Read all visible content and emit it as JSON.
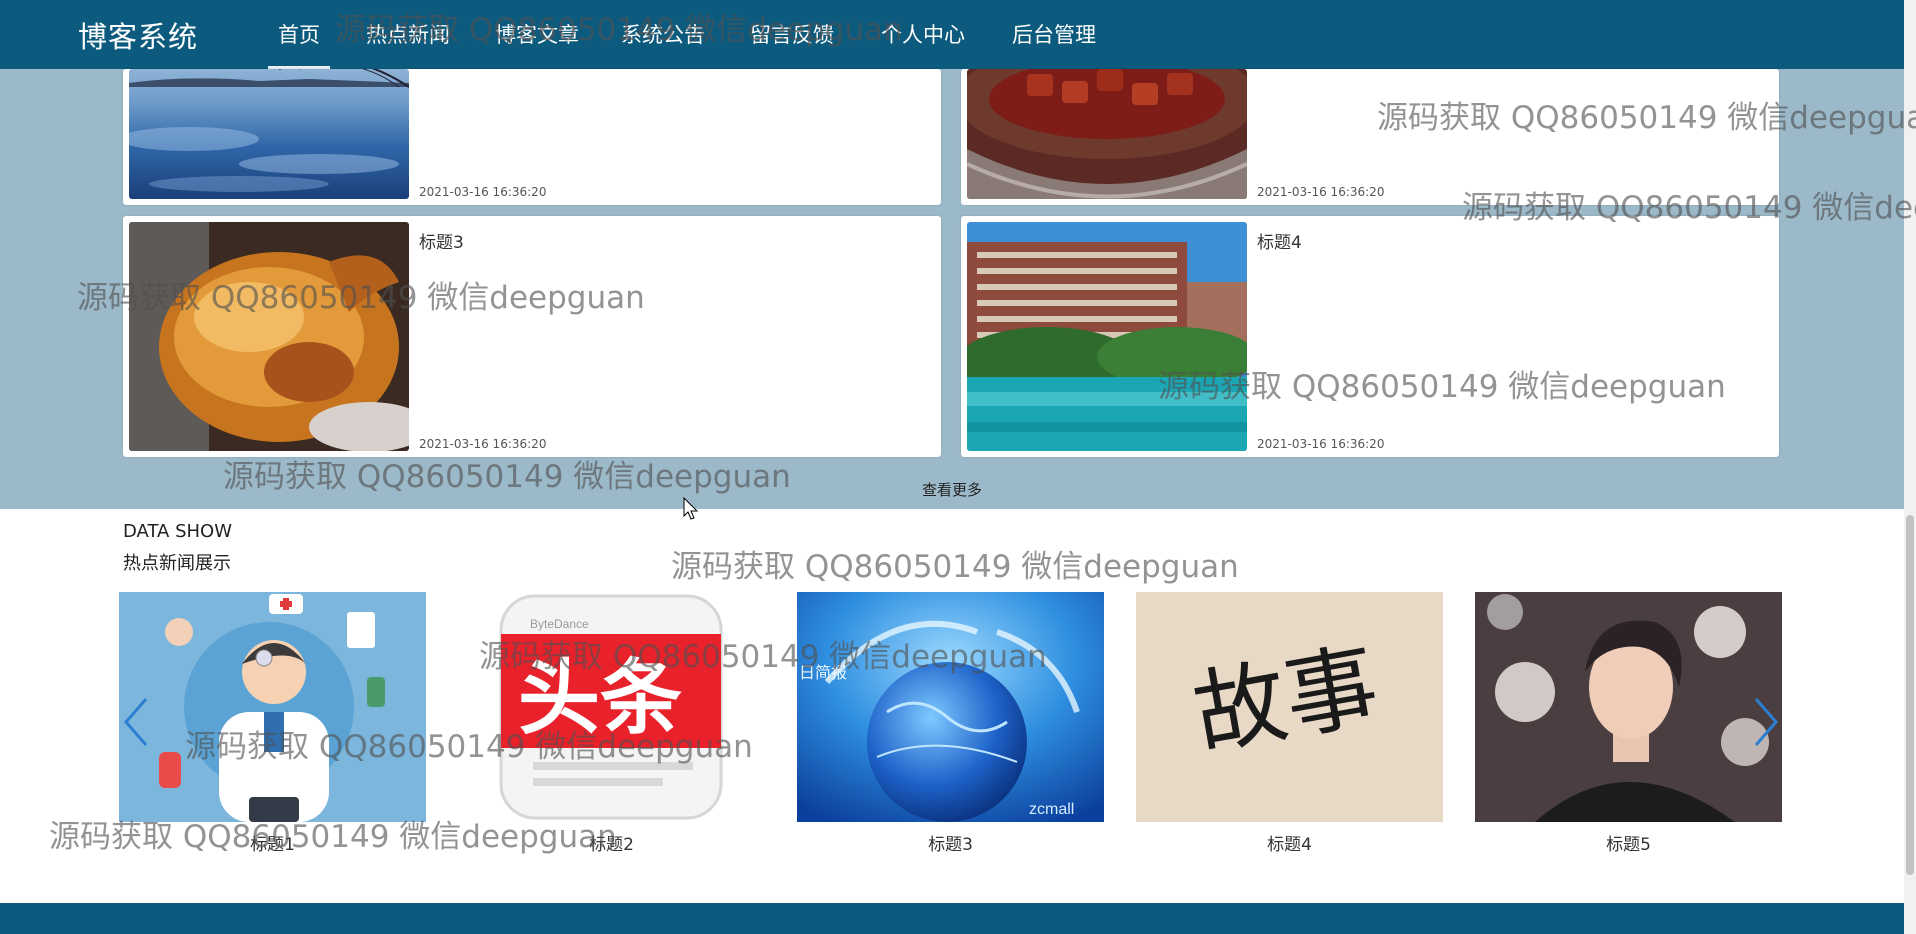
{
  "nav": {
    "brand": "博客系统",
    "items": [
      "首页",
      "热点新闻",
      "博客文章",
      "系统公告",
      "留言反馈",
      "个人中心",
      "后台管理"
    ]
  },
  "news_cards": [
    {
      "title": "",
      "date": "2021-03-16 16:36:20",
      "image": "lake-bridge-sunset"
    },
    {
      "title": "",
      "date": "2021-03-16 16:36:20",
      "image": "braised-pork-pot"
    },
    {
      "title": "标题3",
      "date": "2021-03-16 16:36:20",
      "image": "roast-chicken"
    },
    {
      "title": "标题4",
      "date": "2021-03-16 16:36:20",
      "image": "hotel-pool"
    }
  ],
  "more_label": "查看更多",
  "data_show": {
    "title_en": "DATA SHOW",
    "title_cn": "热点新闻展示",
    "items": [
      {
        "caption": "标题1",
        "image": "doctor-illustration"
      },
      {
        "caption": "标题2",
        "image": "toutiao-logo",
        "image_text": [
          "ByteDance",
          "头条"
        ]
      },
      {
        "caption": "标题3",
        "image": "globe-network",
        "image_text": [
          "日简报",
          "zcmall"
        ]
      },
      {
        "caption": "标题4",
        "image": "calligraphy",
        "image_text": [
          "故事"
        ]
      },
      {
        "caption": "标题5",
        "image": "portrait-man"
      }
    ],
    "prev_icon": "chevron-left-icon",
    "next_icon": "chevron-right-icon"
  },
  "watermark": "源码获取 QQ86050149 微信deepguan",
  "colors": {
    "nav_bg": "#0c5b7e",
    "section_bg": "#9cb9c9",
    "arrow": "#2b7fd0"
  }
}
